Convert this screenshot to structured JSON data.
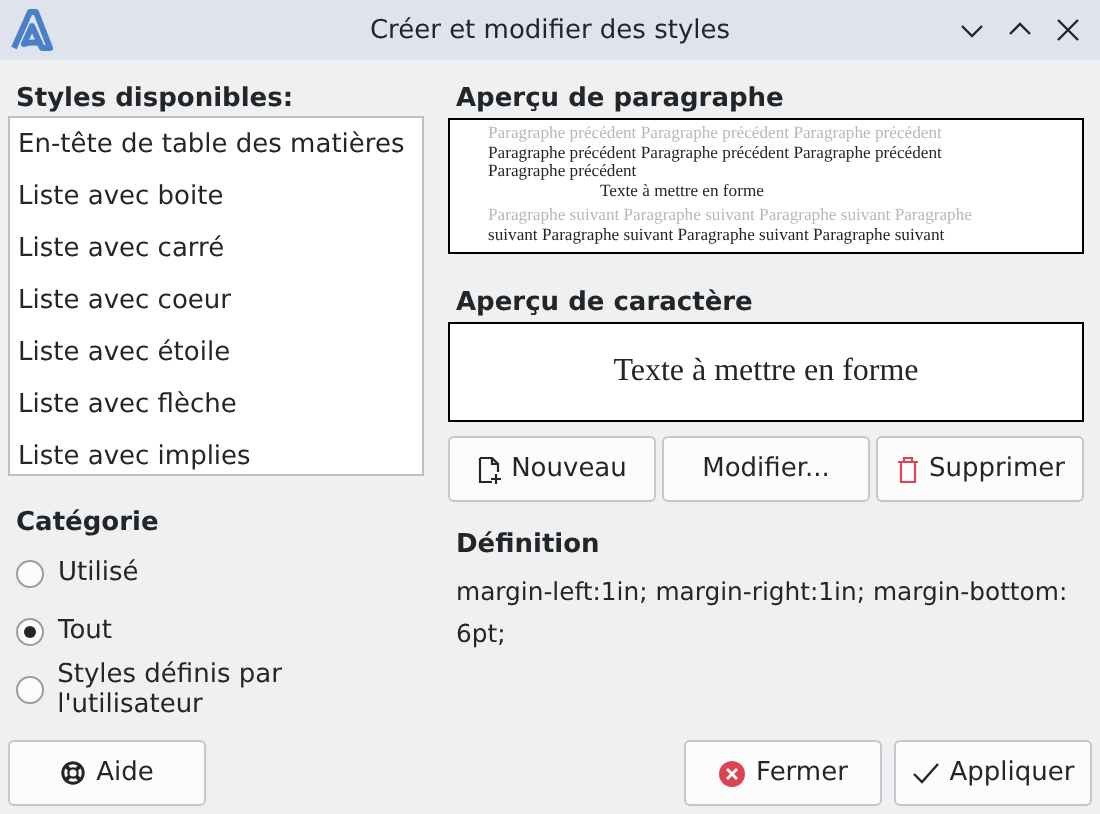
{
  "window": {
    "title": "Créer et modifier des styles"
  },
  "styles": {
    "label": "Styles disponibles:",
    "items": [
      {
        "text": "En-tête de table des matières",
        "selected": false
      },
      {
        "text": "Liste avec boite",
        "selected": false
      },
      {
        "text": "Liste avec carré",
        "selected": false
      },
      {
        "text": "Liste avec coeur",
        "selected": false
      },
      {
        "text": "Liste avec étoile",
        "selected": false
      },
      {
        "text": "Liste avec flèche",
        "selected": false
      },
      {
        "text": "Liste avec implies",
        "selected": false
      }
    ]
  },
  "category": {
    "label": "Catégorie",
    "options": [
      {
        "label": "Utilisé",
        "selected": false
      },
      {
        "label": "Tout",
        "selected": true
      },
      {
        "label": "Styles définis par l'utilisateur",
        "selected": false
      }
    ]
  },
  "paragraph_preview": {
    "label": "Aperçu de paragraphe",
    "lines": [
      {
        "kind": "faded",
        "text": "Paragraphe précédent Paragraphe précédent Paragraphe précédent"
      },
      {
        "kind": "plain",
        "text": "Paragraphe précédent Paragraphe précédent Paragraphe précédent"
      },
      {
        "kind": "plain",
        "text": "Paragraphe précédent"
      },
      {
        "kind": "sample",
        "text": "Texte à mettre en forme"
      },
      {
        "kind": "faded",
        "text": "Paragraphe suivant Paragraphe suivant Paragraphe suivant Paragraphe"
      },
      {
        "kind": "plain",
        "text": "suivant Paragraphe suivant Paragraphe suivant Paragraphe suivant"
      }
    ]
  },
  "character_preview": {
    "label": "Aperçu de caractère",
    "text": "Texte à mettre en forme"
  },
  "actions": [
    {
      "kind": "new",
      "label": "Nouveau"
    },
    {
      "kind": "edit",
      "label": "Modifier..."
    },
    {
      "kind": "delete",
      "label": "Supprimer"
    }
  ],
  "definition": {
    "label": "Définition",
    "text": "margin-left:1in; margin-right:1in; margin-bottom: 6pt;"
  },
  "buttons": [
    {
      "kind": "help",
      "label": "Aide"
    },
    {
      "kind": "close",
      "label": "Fermer"
    },
    {
      "kind": "apply",
      "label": "Appliquer"
    }
  ]
}
